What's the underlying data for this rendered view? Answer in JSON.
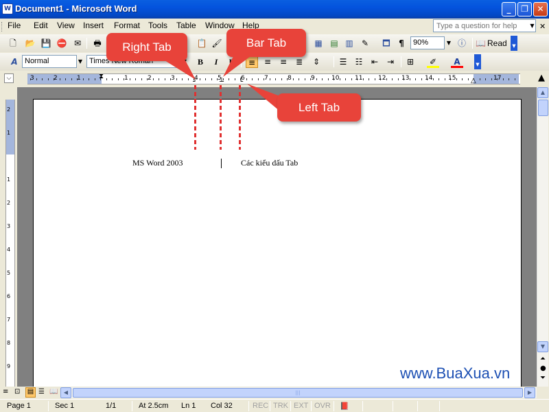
{
  "window": {
    "title": "Document1 - Microsoft Word",
    "app_icon": "W"
  },
  "menu": {
    "items": [
      {
        "label": "File",
        "key": "F"
      },
      {
        "label": "Edit",
        "key": "E"
      },
      {
        "label": "View",
        "key": "V"
      },
      {
        "label": "Insert",
        "key": "I"
      },
      {
        "label": "Format",
        "key": "o"
      },
      {
        "label": "Tools",
        "key": "T"
      },
      {
        "label": "Table",
        "key": "a"
      },
      {
        "label": "Window",
        "key": "W"
      },
      {
        "label": "Help",
        "key": "H"
      }
    ],
    "ask_placeholder": "Type a question for help"
  },
  "standard_toolbar": {
    "zoom": "90%",
    "read_label": "Read"
  },
  "formatting_toolbar": {
    "style": "Normal",
    "font": "Times New Roman",
    "bold": "B",
    "italic": "I",
    "underline": "U"
  },
  "ruler": {
    "numbers": [
      "3",
      "2",
      "1",
      "1",
      "1",
      "2",
      "3",
      "4",
      "5",
      "6",
      "7",
      "8",
      "9",
      "10",
      "11",
      "12",
      "13",
      "14",
      "15",
      "17"
    ]
  },
  "vertical_ruler": {
    "numbers": [
      "2",
      "1",
      "1",
      "2",
      "3",
      "4",
      "5",
      "6",
      "7",
      "8",
      "9"
    ]
  },
  "document": {
    "text_right_tab": "MS Word  2003",
    "text_left_tab": "Các kiểu dấu Tab"
  },
  "callouts": {
    "right_tab": "Right Tab",
    "bar_tab": "Bar Tab",
    "left_tab": "Left Tab"
  },
  "status": {
    "page": "Page  1",
    "sec": "Sec  1",
    "pages": "1/1",
    "at": "At  2.5cm",
    "ln": "Ln  1",
    "col": "Col  32",
    "rec": "REC",
    "trk": "TRK",
    "ext": "EXT",
    "ovr": "OVR"
  },
  "watermark": "www.BuaXua.vn",
  "colors": {
    "callout": "#e8433a",
    "title_bar": "#0453dd",
    "highlight": "#ffff00",
    "font_color": "#ff0000"
  }
}
